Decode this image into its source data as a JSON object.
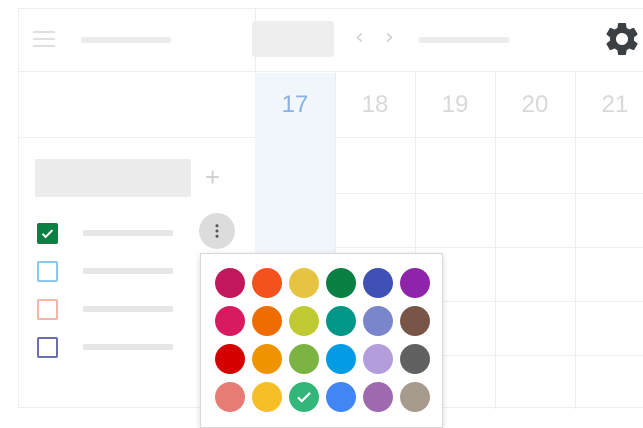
{
  "header": {
    "today_button_label": "",
    "prev_icon": "chevron-left-icon",
    "next_icon": "chevron-right-icon",
    "prev_glyph": "‹",
    "next_glyph": "›",
    "settings_icon": "gear-icon"
  },
  "week": {
    "days": [
      {
        "number": "17",
        "today": true
      },
      {
        "number": "18",
        "today": false
      },
      {
        "number": "19",
        "today": false
      },
      {
        "number": "20",
        "today": false
      },
      {
        "number": "21",
        "today": false
      }
    ]
  },
  "sidebar": {
    "add_glyph": "+",
    "calendars": [
      {
        "color": "#0b8043",
        "checked": true
      },
      {
        "color": "#8cc9e8",
        "checked": false
      },
      {
        "color": "#f4b6a6",
        "checked": false
      },
      {
        "color": "#6a6fb0",
        "checked": false
      }
    ],
    "more_icon": "more-vert-icon"
  },
  "color_palette": {
    "selected_index": 20,
    "colors": [
      "#c2185b",
      "#f4511e",
      "#e4c441",
      "#0b8043",
      "#3f51b5",
      "#8e24aa",
      "#d81b60",
      "#ef6c00",
      "#c0ca33",
      "#009688",
      "#7986cb",
      "#795548",
      "#d50000",
      "#f09300",
      "#7cb342",
      "#039be5",
      "#b39ddb",
      "#616161",
      "#e67c73",
      "#f6bf26",
      "#33b679",
      "#4285f4",
      "#9e69af",
      "#a79b8e"
    ]
  }
}
